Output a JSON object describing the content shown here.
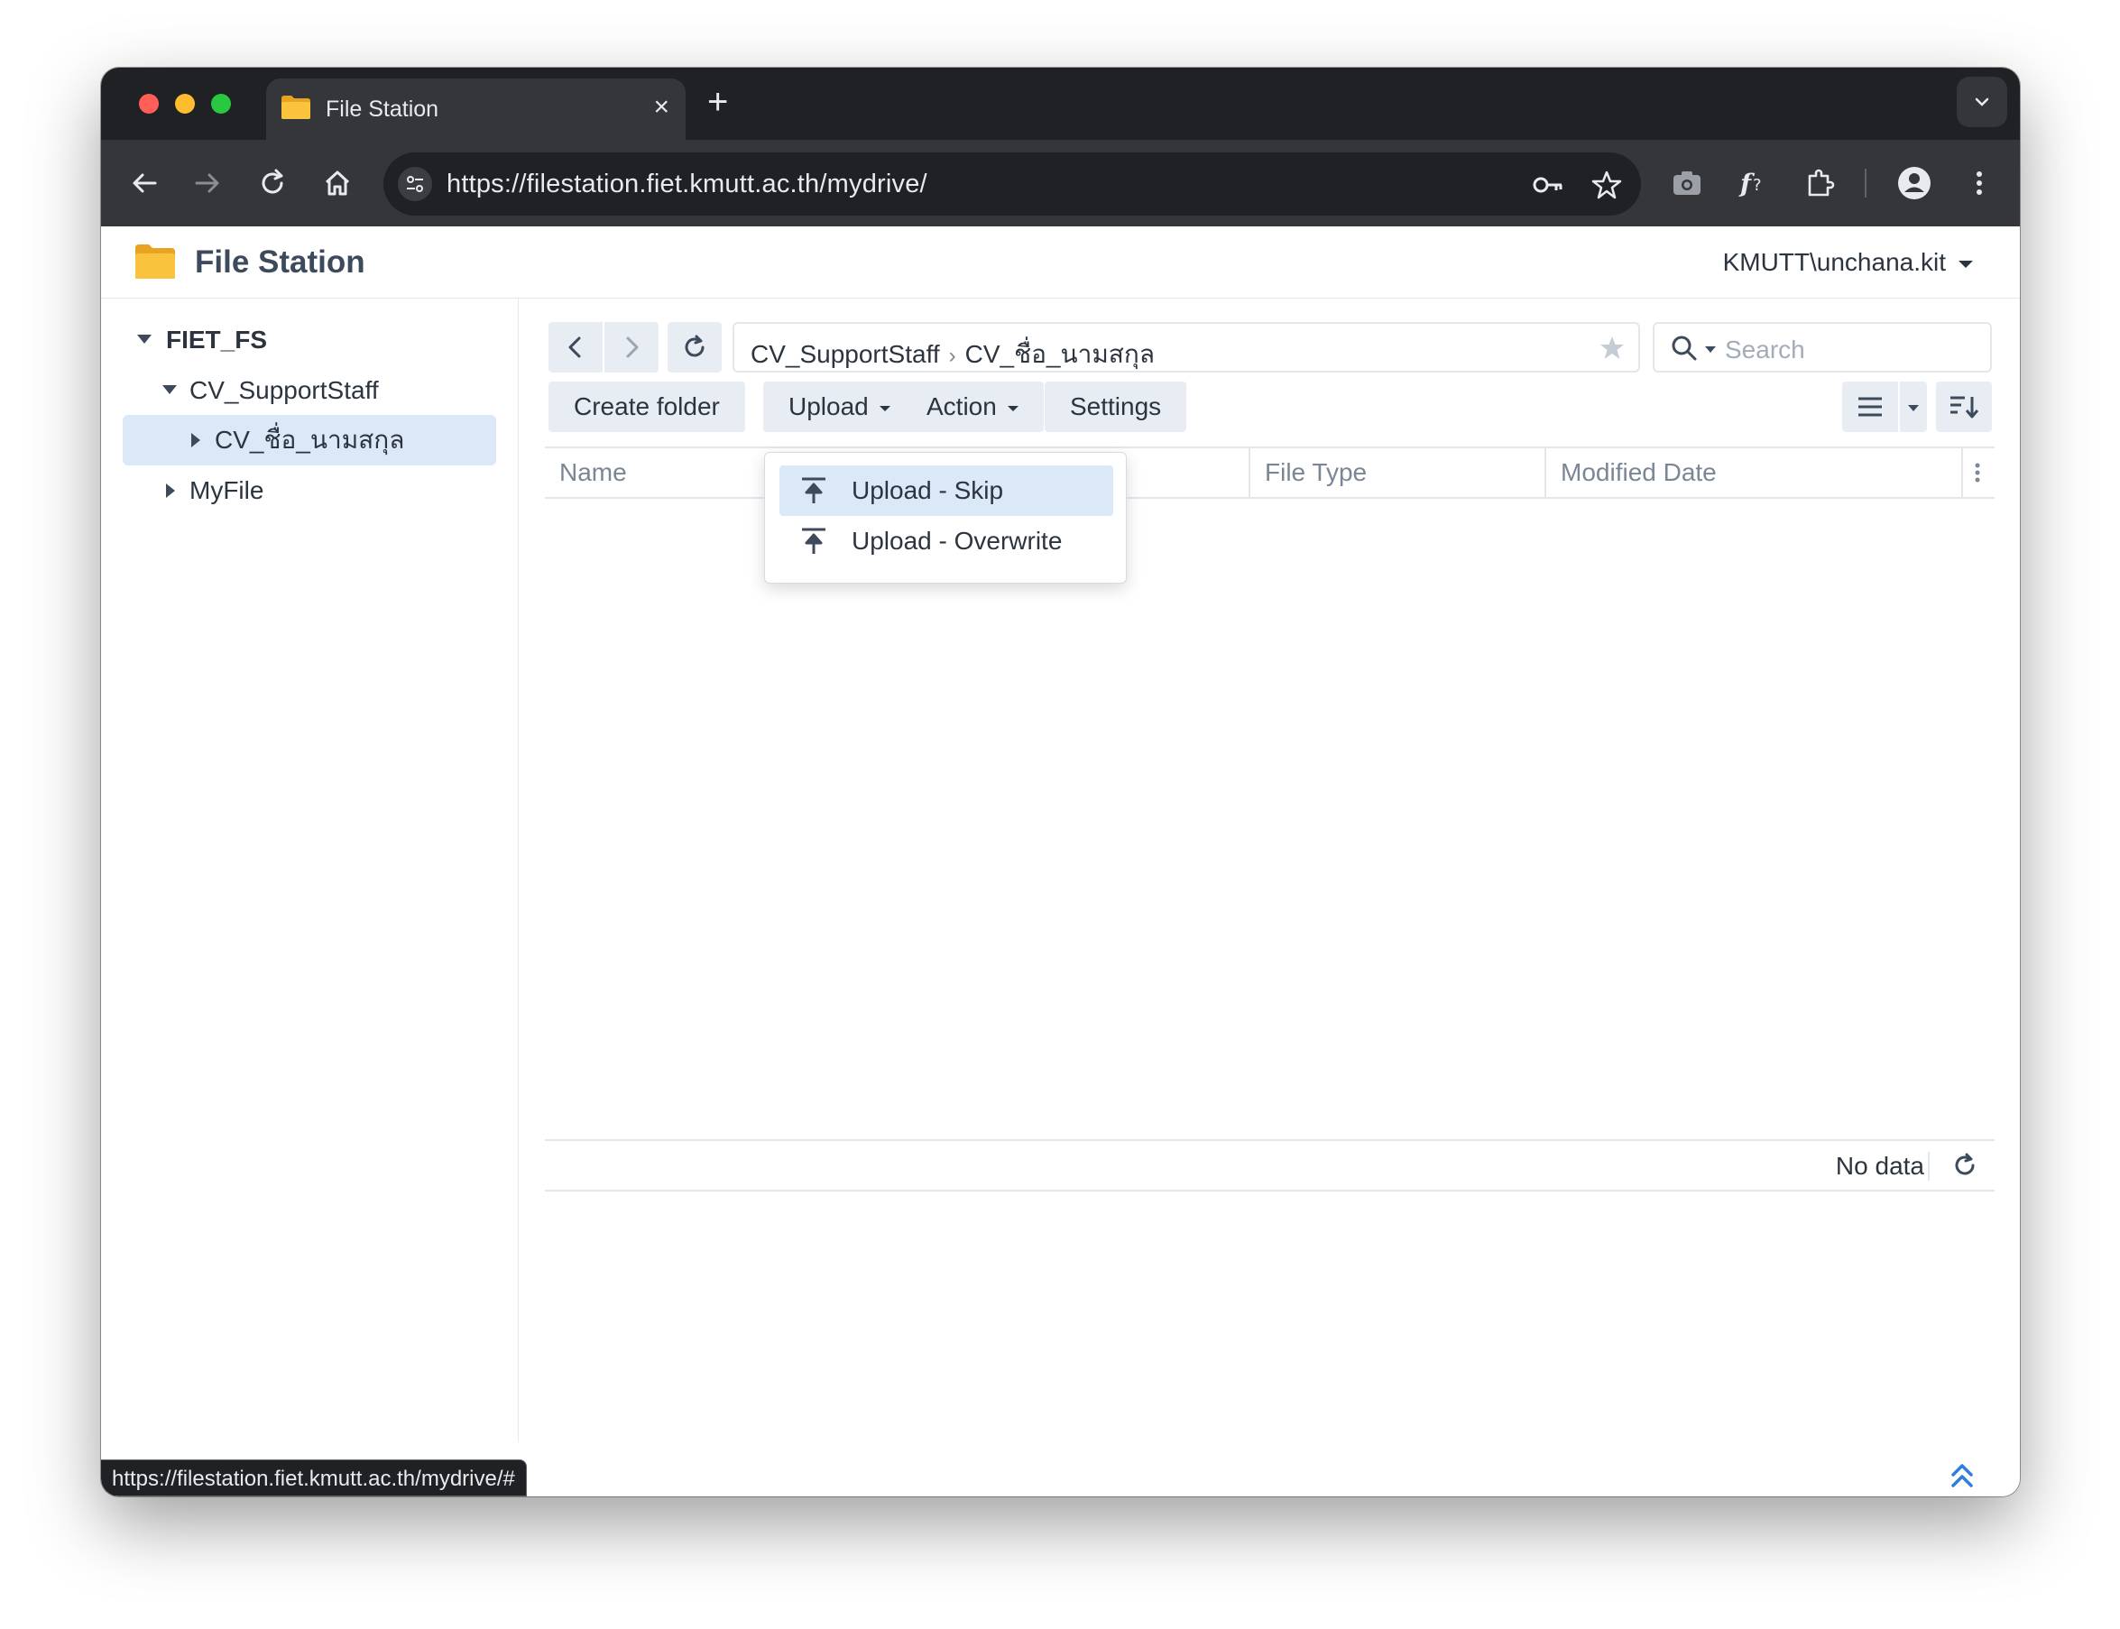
{
  "browser": {
    "tab_title": "File Station",
    "tab_close": "×",
    "new_tab": "+",
    "url": "https://filestation.fiet.kmutt.ac.th/mydrive/",
    "status_url": "https://filestation.fiet.kmutt.ac.th/mydrive/#",
    "icons": [
      "back-icon",
      "forward-icon",
      "reload-icon",
      "home-icon",
      "site-settings-icon",
      "password-key-icon",
      "bookmark-star-icon",
      "camera-icon",
      "formula-icon",
      "extensions-icon",
      "profile-icon",
      "more-menu-icon",
      "tab-search-icon"
    ]
  },
  "app": {
    "title": "File Station",
    "user": "KMUTT\\unchana.kit"
  },
  "sidebar": {
    "items": [
      {
        "label": "FIET_FS",
        "expanded": true,
        "level": 0
      },
      {
        "label": "CV_SupportStaff",
        "expanded": true,
        "level": 1
      },
      {
        "label": "CV_ชื่อ_นามสกุล",
        "expanded": false,
        "level": 2,
        "selected": true
      },
      {
        "label": "MyFile",
        "expanded": false,
        "level": 1
      }
    ]
  },
  "path": {
    "segments": [
      "CV_SupportStaff",
      "CV_ชื่อ_นามสกุล"
    ],
    "separator": "›"
  },
  "search": {
    "placeholder": "Search"
  },
  "toolbar": {
    "create_folder": "Create folder",
    "upload": "Upload",
    "action": "Action",
    "settings": "Settings"
  },
  "upload_menu": {
    "items": [
      {
        "label": "Upload - Skip",
        "active": true
      },
      {
        "label": "Upload - Overwrite",
        "active": false
      }
    ]
  },
  "grid": {
    "columns": [
      "Name",
      "File Type",
      "Modified Date"
    ],
    "footer_text": "No data"
  },
  "colors": {
    "selected_bg": "#dbe8f8",
    "button_bg": "#e8edf3",
    "text": "#2c3440",
    "muted": "#7a8696",
    "folder": "#f7b733"
  }
}
